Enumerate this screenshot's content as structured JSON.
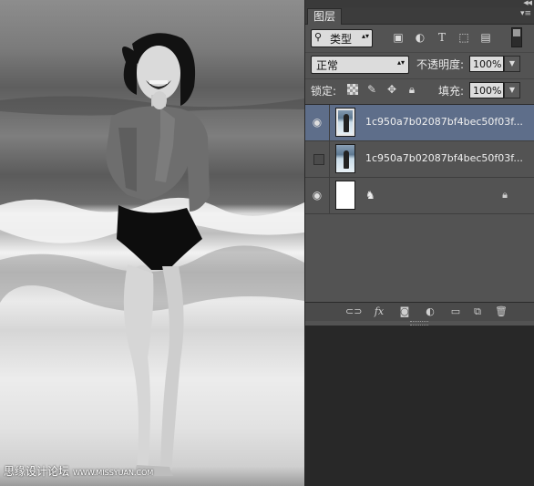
{
  "canvas": {
    "watermark_main": "思缘设计论坛",
    "watermark_site": "WWW.MISSYUAN.COM"
  },
  "panel": {
    "tab_title": "图层",
    "menu_icon": "panel-menu-icon",
    "filter_kind": "类型",
    "filter_icons": [
      "image-filter-icon",
      "adjustment-filter-icon",
      "type-filter-icon",
      "shape-filter-icon",
      "smart-object-filter-icon"
    ],
    "blend_mode": "正常",
    "opacity_label": "不透明度:",
    "opacity_value": "100%",
    "lock_label": "锁定:",
    "lock_icons": [
      "lock-transparent-icon",
      "lock-image-icon",
      "lock-position-icon",
      "lock-all-icon"
    ],
    "fill_label": "填充:",
    "fill_value": "100%",
    "layers": [
      {
        "name": "1c950a7b02087bf4bec50f03f...",
        "visible": true,
        "selected": true
      },
      {
        "name": "1c950a7b02087bf4bec50f03f...",
        "visible": false,
        "selected": false
      },
      {
        "name": "",
        "visible": true,
        "selected": false,
        "locked": true,
        "effect_glyph": "♞",
        "note": "background"
      }
    ],
    "bottom_icons": [
      "link-layers-icon",
      "fx-icon",
      "add-mask-icon",
      "adjustment-layer-icon",
      "new-group-icon",
      "new-layer-icon",
      "delete-layer-icon"
    ],
    "fx_label": "fx"
  }
}
